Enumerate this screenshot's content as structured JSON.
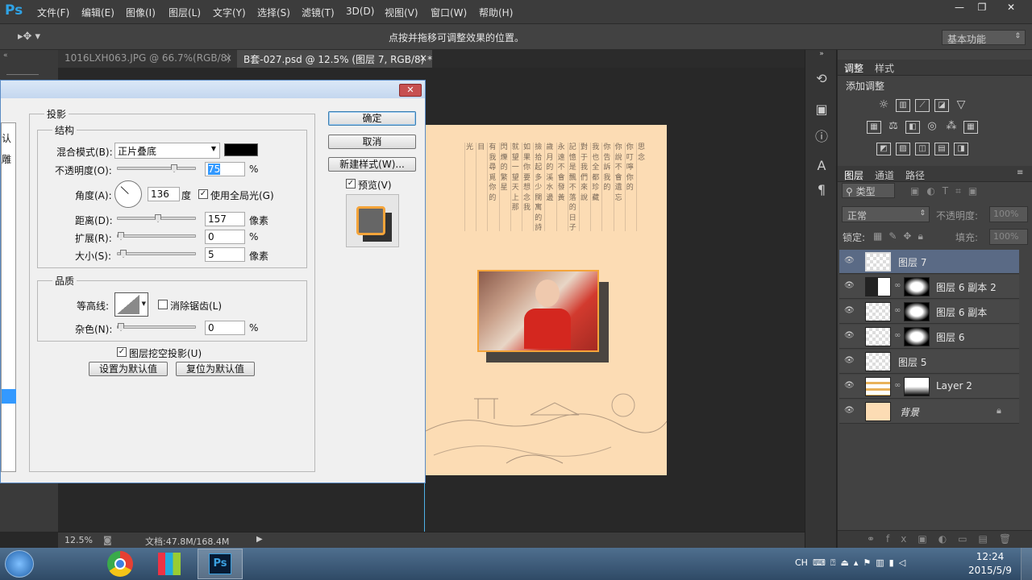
{
  "app": {
    "logo": "Ps"
  },
  "menu": [
    "文件(F)",
    "编辑(E)",
    "图像(I)",
    "图层(L)",
    "文字(Y)",
    "选择(S)",
    "滤镜(T)",
    "3D(D)",
    "视图(V)",
    "窗口(W)",
    "帮助(H)"
  ],
  "options": {
    "hint": "点按并拖移可调整效果的位置。",
    "workspace": "基本功能"
  },
  "tabs": [
    {
      "label": "1016LXH063.JPG @ 66.7%(RGB/8)",
      "close": "×"
    },
    {
      "label": "B套-027.psd @ 12.5% (图层 7, RGB/8) *",
      "close": "×"
    }
  ],
  "dialog": {
    "section": "投影",
    "structure_title": "结构",
    "blend_label": "混合模式(B):",
    "blend_value": "正片叠底",
    "opacity_label": "不透明度(O):",
    "opacity_value": "75",
    "pct": "%",
    "angle_label": "角度(A):",
    "angle_value": "136",
    "angle_unit": "度",
    "global_light": "使用全局光(G)",
    "distance_label": "距离(D):",
    "distance_value": "157",
    "px": "像素",
    "spread_label": "扩展(R):",
    "spread_value": "0",
    "size_label": "大小(S):",
    "size_value": "5",
    "quality_title": "品质",
    "contour_label": "等高线:",
    "antialias": "消除锯齿(L)",
    "noise_label": "杂色(N):",
    "noise_value": "0",
    "knockout": "图层挖空投影(U)",
    "set_default": "设置为默认值",
    "reset_default": "复位为默认值",
    "ok": "确定",
    "cancel": "取消",
    "new_style": "新建样式(W)...",
    "preview": "预览(V)",
    "sidebar_frag": [
      "认",
      "雕"
    ],
    "levels": {
      "opacity": 0.75,
      "distance": 0.52,
      "spread": 0,
      "size": 0.03,
      "noise": 0
    }
  },
  "panels": {
    "adjust_tab": "调整",
    "styles_tab": "样式",
    "add_adjust": "添加调整",
    "layers_tab": "图层",
    "channels_tab": "通道",
    "paths_tab": "路径",
    "filter_kind": "类型",
    "blend_mode": "正常",
    "opacity_label": "不透明度:",
    "opacity_value": "100%",
    "lock_label": "锁定:",
    "fill_label": "填充:",
    "fill_value": "100%"
  },
  "layers": [
    {
      "name": "图层 7",
      "selected": true,
      "mask": false
    },
    {
      "name": "图层 6 副本 2",
      "selected": false,
      "mask": true
    },
    {
      "name": "图层 6 副本",
      "selected": false,
      "mask": true
    },
    {
      "name": "图层 6",
      "selected": false,
      "mask": true
    },
    {
      "name": "图层 5",
      "selected": false,
      "mask": false
    },
    {
      "name": "Layer 2",
      "selected": false,
      "mask": true
    },
    {
      "name": "背景",
      "selected": false,
      "mask": false
    }
  ],
  "status": {
    "zoom": "12.5%",
    "doc_info": "文档:47.8M/168.4M"
  },
  "taskbar": {
    "lang": "CH",
    "time": "12:24",
    "date": "2015/5/9"
  },
  "poem_columns": [
    "思 念",
    "你 叮 嚀 你 的",
    "你 說 不 會 遺 忘",
    "你 告 訴 我 的",
    "我 也 全 都 珍 藏",
    "對 于 我 們 來 說",
    "記 憶 是 飄 不 落 的 日 子",
    "永 遠 不 會 發 黃",
    "歲 月 的 溪 水 邊",
    "撿 拾 起 多 少 闊 寓 的 詩 行",
    "如 果 你 要 想 念 我",
    "就 望 一 望 天 上 那",
    "閃 爍 的 繁 星",
    "有 我 尋 覓 你 的",
    "目",
    "光"
  ],
  "colors": {
    "accent": "#2fa3e6",
    "canvas_bg": "#fcdcb4",
    "selected_layer": "#5a6a85"
  }
}
